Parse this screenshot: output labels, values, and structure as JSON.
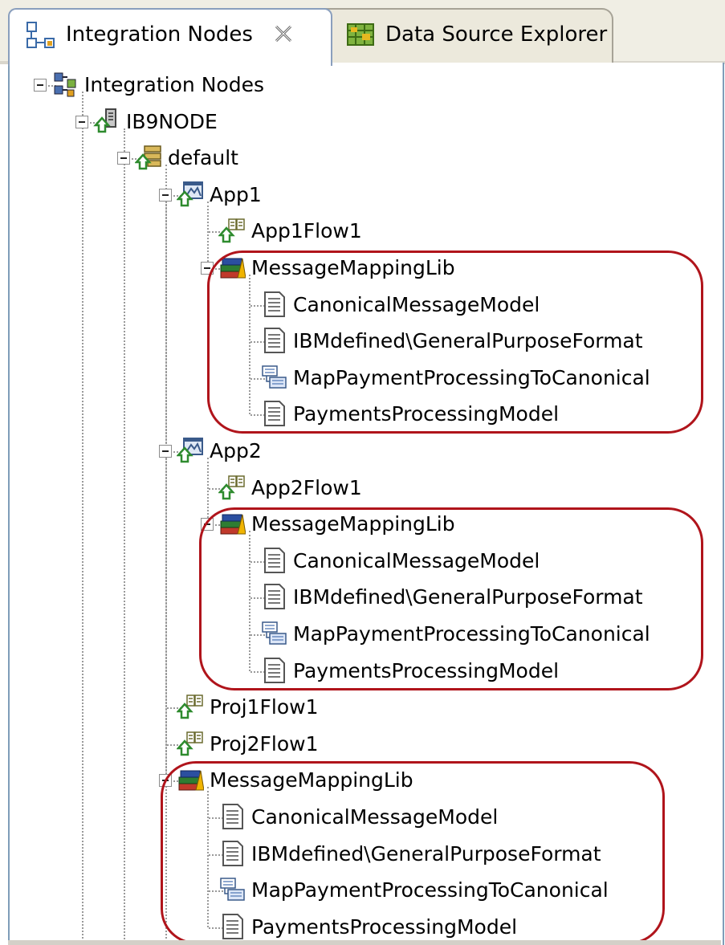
{
  "tabs": [
    {
      "label": "Integration Nodes",
      "icon": "integration-nodes-icon",
      "active": true
    },
    {
      "label": "Data Source Explorer",
      "icon": "data-source-explorer-icon",
      "active": false
    }
  ],
  "tree": [
    {
      "label": "Integration Nodes",
      "icon": "integration-nodes-icon",
      "depth": 0,
      "expander": true
    },
    {
      "label": "IB9NODE",
      "icon": "integration-node-icon",
      "depth": 1,
      "expander": true
    },
    {
      "label": "default",
      "icon": "integration-server-icon",
      "depth": 2,
      "expander": true
    },
    {
      "label": "App1",
      "icon": "application-icon",
      "depth": 3,
      "expander": true
    },
    {
      "label": "App1Flow1",
      "icon": "message-flow-icon",
      "depth": 4
    },
    {
      "label": "MessageMappingLib",
      "icon": "library-icon",
      "depth": 4,
      "expander": true
    },
    {
      "label": "CanonicalMessageModel",
      "icon": "document-icon",
      "depth": 5
    },
    {
      "label": "IBMdefined\\GeneralPurposeFormat",
      "icon": "document-icon",
      "depth": 5
    },
    {
      "label": "MapPaymentProcessingToCanonical",
      "icon": "map-icon",
      "depth": 5
    },
    {
      "label": "PaymentsProcessingModel",
      "icon": "document-icon",
      "depth": 5
    },
    {
      "label": "App2",
      "icon": "application-icon",
      "depth": 3,
      "expander": true
    },
    {
      "label": "App2Flow1",
      "icon": "message-flow-icon",
      "depth": 4
    },
    {
      "label": "MessageMappingLib",
      "icon": "library-icon",
      "depth": 4,
      "expander": true
    },
    {
      "label": "CanonicalMessageModel",
      "icon": "document-icon",
      "depth": 5
    },
    {
      "label": "IBMdefined\\GeneralPurposeFormat",
      "icon": "document-icon",
      "depth": 5
    },
    {
      "label": "MapPaymentProcessingToCanonical",
      "icon": "map-icon",
      "depth": 5
    },
    {
      "label": "PaymentsProcessingModel",
      "icon": "document-icon",
      "depth": 5
    },
    {
      "label": "Proj1Flow1",
      "icon": "message-flow-icon",
      "depth": 3
    },
    {
      "label": "Proj2Flow1",
      "icon": "message-flow-icon",
      "depth": 3
    },
    {
      "label": "MessageMappingLib",
      "icon": "library-icon",
      "depth": 3,
      "expander": true
    },
    {
      "label": "CanonicalMessageModel",
      "icon": "document-icon",
      "depth": 4
    },
    {
      "label": "IBMdefined\\GeneralPurposeFormat",
      "icon": "document-icon",
      "depth": 4
    },
    {
      "label": "MapPaymentProcessingToCanonical",
      "icon": "map-icon",
      "depth": 4
    },
    {
      "label": "PaymentsProcessingModel",
      "icon": "document-icon",
      "depth": 4
    }
  ],
  "colors": {
    "highlight_ring": "#b0141b",
    "tree_connector": "#9a9a9a",
    "tab_border": "#8a9fbd"
  }
}
